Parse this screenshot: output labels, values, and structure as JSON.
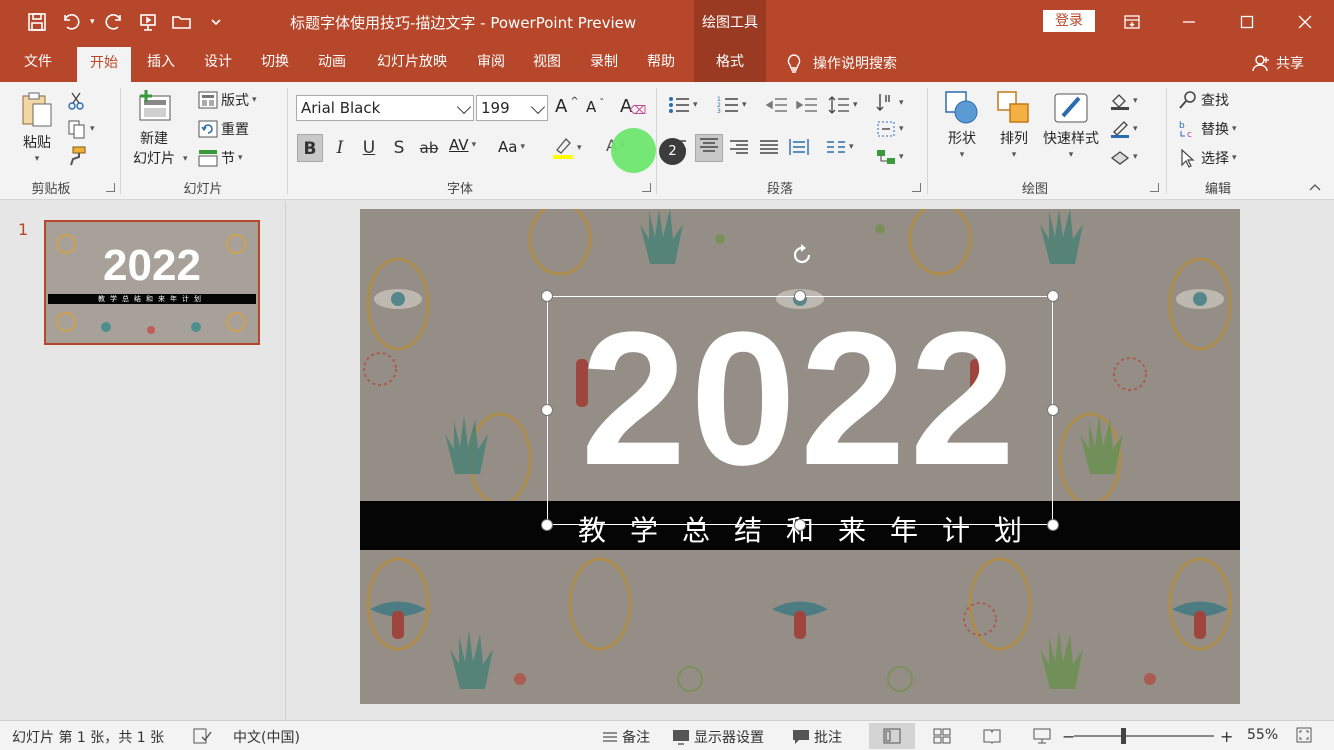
{
  "titlebar": {
    "document_title": "标题字体使用技巧-描边文字  -  PowerPoint Preview",
    "context_group": "绘图工具",
    "login": "登录"
  },
  "tabs": [
    {
      "label": "文件"
    },
    {
      "label": "开始"
    },
    {
      "label": "插入"
    },
    {
      "label": "设计"
    },
    {
      "label": "切换"
    },
    {
      "label": "动画"
    },
    {
      "label": "幻灯片放映"
    },
    {
      "label": "审阅"
    },
    {
      "label": "视图"
    },
    {
      "label": "录制"
    },
    {
      "label": "帮助"
    },
    {
      "label": "格式"
    }
  ],
  "active_tab": "开始",
  "tell_me": "操作说明搜索",
  "share": "共享",
  "ribbon": {
    "clipboard": {
      "paste": "粘贴",
      "group": "剪贴板"
    },
    "slides": {
      "new_slide_1": "新建",
      "new_slide_2": "幻灯片",
      "layout": "版式",
      "reset": "重置",
      "section": "节",
      "group": "幻灯片"
    },
    "font": {
      "font_name": "Arial Black",
      "font_size": "199",
      "group": "字体"
    },
    "paragraph": {
      "group": "段落"
    },
    "drawing": {
      "shapes": "形状",
      "arrange": "排列",
      "quick_styles": "快速样式",
      "group": "绘图"
    },
    "editing": {
      "find": "查找",
      "replace": "替换",
      "select": "选择",
      "group": "编辑"
    }
  },
  "badge": "2",
  "slide_panel": {
    "number": "1"
  },
  "slide": {
    "year": "2022",
    "subtitle": "教学总结和来年计划",
    "thumb_year": "2022",
    "thumb_subtitle": "教学总结和来年计划"
  },
  "statusbar": {
    "slide_info": "幻灯片 第 1 张，共 1 张",
    "language": "中文(中国)",
    "notes": "备注",
    "display_settings": "显示器设置",
    "comments": "批注",
    "zoom": "55%"
  },
  "colors": {
    "accent": "#b7472a",
    "context": "#9b3a22",
    "highlight": "#ffff00"
  }
}
